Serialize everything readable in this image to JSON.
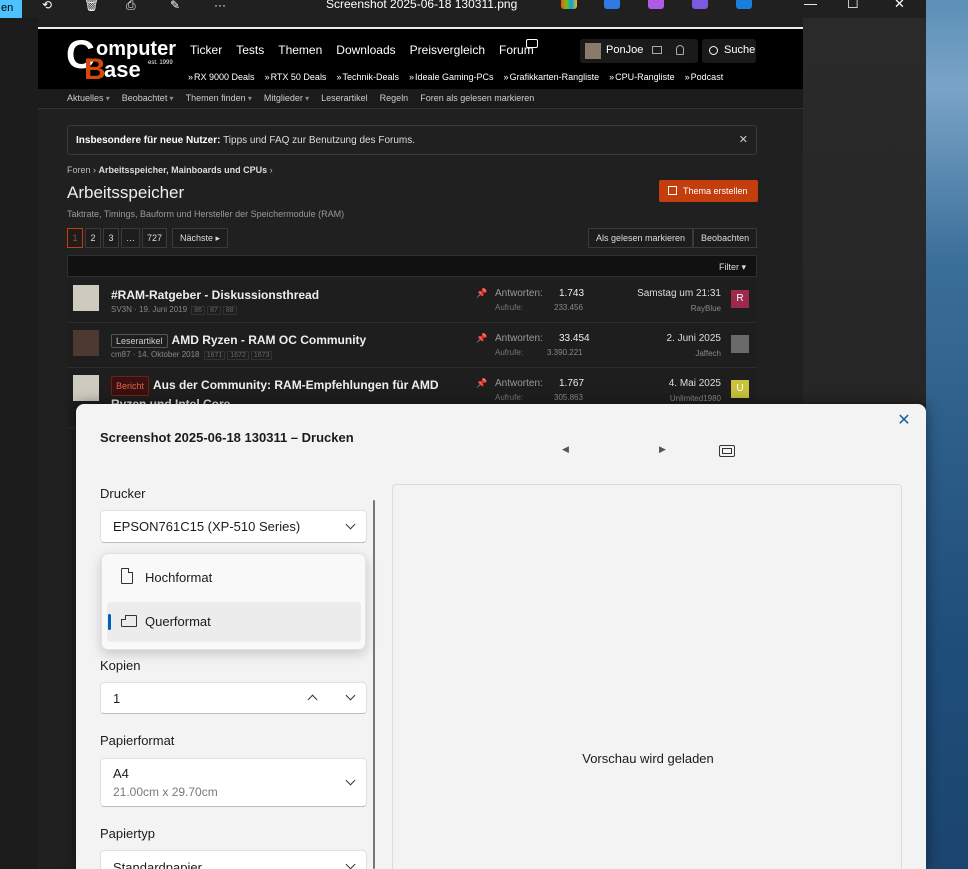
{
  "window": {
    "badge": "en",
    "title": "Screenshot 2025-06-18 130311.png",
    "controls": {
      "minimize": "—",
      "maximize": "☐",
      "close": "✕"
    },
    "toolbar_more": "···"
  },
  "site": {
    "logo": {
      "c": "C",
      "word1": "omputer",
      "b": "B",
      "word2": "ase",
      "est": "est. 1999"
    },
    "nav": [
      "Ticker",
      "Tests",
      "Themen",
      "Downloads",
      "Preisvergleich",
      "Forum"
    ],
    "user": "PonJoe",
    "search": "Suche",
    "deals": [
      "RX 9000 Deals",
      "RTX 50 Deals",
      "Technik-Deals",
      "Ideale Gaming-PCs",
      "Grafikkarten-Rangliste",
      "CPU-Rangliste",
      "Podcast"
    ],
    "subnav": [
      "Aktuelles",
      "Beobachtet",
      "Themen finden",
      "Mitglieder",
      "Leserartikel",
      "Regeln",
      "Foren als gelesen markieren"
    ],
    "notice_bold": "Insbesondere für neue Nutzer:",
    "notice_text": " Tipps und FAQ zur Benutzung des Forums.",
    "notice_close": "✕",
    "crumb_root": "Foren",
    "crumb_sep": "›",
    "crumb_section": "Arbeitsspeicher, Mainboards und CPUs",
    "page_title": "Arbeitsspeicher",
    "page_desc": "Taktrate, Timings, Bauform und Hersteller der Speichermodule (RAM)",
    "new_thread": "Thema erstellen",
    "pager": [
      "1",
      "2",
      "3",
      "…",
      "727"
    ],
    "pager_next": "Nächste ▸",
    "mark_read": "Als gelesen markieren",
    "watch": "Beobachten",
    "filter": "Filter ▾",
    "threads": [
      {
        "tag": "",
        "title": "#RAM-Ratgeber - Diskussionsthread",
        "author_date": "SV3N · 19. Juni 2019",
        "pages": [
          "86",
          "87",
          "88"
        ],
        "replies_label": "Antworten:",
        "replies": "1.743",
        "views_label": "Aufrufe:",
        "views": "233.456",
        "last_date": "Samstag um 21:31",
        "last_user": "RayBlue",
        "avatar_letter": "R",
        "avatar_color": "#9c2a4a"
      },
      {
        "tag": "Leserartikel",
        "title": "AMD Ryzen - RAM OC Community",
        "author_date": "cm87 · 14. Oktober 2018",
        "pages": [
          "1671",
          "1672",
          "1673"
        ],
        "replies_label": "Antworten:",
        "replies": "33.454",
        "views_label": "Aufrufe:",
        "views": "3.390.221",
        "last_date": "2. Juni 2025",
        "last_user": "Jaffech",
        "avatar_letter": "",
        "avatar_color": "#6a6a6a"
      },
      {
        "tag": "Bericht",
        "title": "Aus der Community: RAM-Empfehlungen für AMD Ryzen und Intel Core",
        "author_date": "",
        "pages": [],
        "replies_label": "Antworten:",
        "replies": "1.767",
        "views_label": "Aufrufe:",
        "views": "305.863",
        "last_date": "4. Mai 2025",
        "last_user": "Unlimited1980",
        "avatar_letter": "U",
        "avatar_color": "#c9c23a"
      }
    ]
  },
  "dialog": {
    "title": "Screenshot 2025-06-18 130311 – Drucken",
    "close": "✕",
    "prev": "◀",
    "next": "▶",
    "printer_label": "Drucker",
    "printer_value": "EPSON761C15 (XP-510 Series)",
    "orientation_options": [
      "Hochformat",
      "Querformat"
    ],
    "orientation_selected": "Querformat",
    "copies_label": "Kopien",
    "copies_value": "1",
    "paper_label": "Papierformat",
    "paper_value": "A4",
    "paper_sub": "21.00cm x 29.70cm",
    "type_label": "Papiertyp",
    "type_value": "Standardpapier",
    "preview_msg": "Vorschau wird geladen"
  },
  "colors": {
    "accent": "#005fb8",
    "brand": "#c43d0c",
    "close_blue": "#1e5fa0"
  }
}
